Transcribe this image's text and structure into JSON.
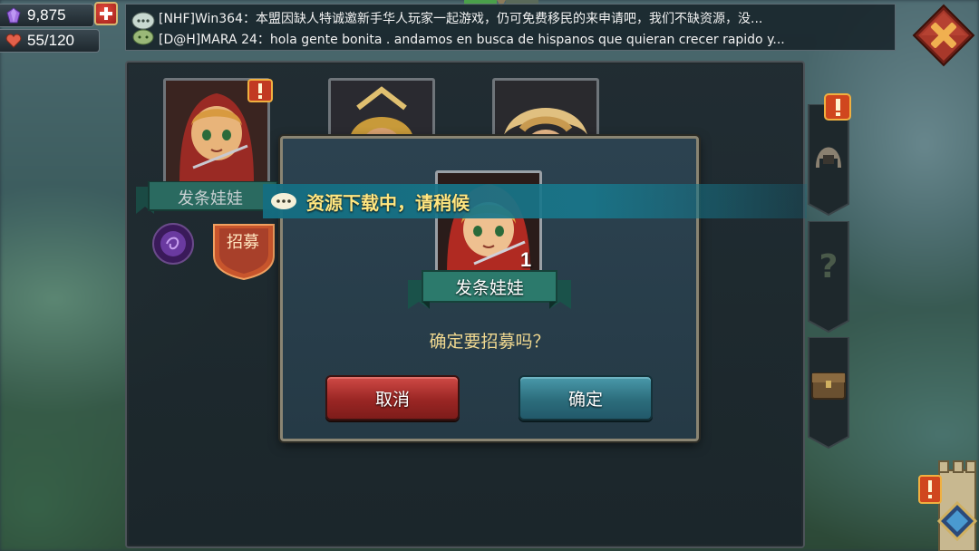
{
  "resources": {
    "gems": "9,875",
    "stamina": "55/120"
  },
  "chat": {
    "line1": "[NHF]Win364：本盟因缺人特诚邀新手华人玩家一起游戏，仍可免费移民的来申请吧，我们不缺资源，没...",
    "line2": "[D@H]MARA 24：hola gente bonita . andamos en busca de hispanos que quieran crecer rapido y..."
  },
  "background_hero": {
    "name": "发条娃娃",
    "recruit_label": "招募"
  },
  "banner": {
    "text": "资源下载中，请稍候"
  },
  "dialog": {
    "hero_name": "发条娃娃",
    "count": "1",
    "question": "确定要招募吗？",
    "cancel_label": "取消",
    "confirm_label": "确定"
  },
  "colors": {
    "accent_gold": "#f0d890",
    "banner_text": "#ffe680",
    "cancel_red": "#9a2624",
    "confirm_teal": "#2c6d7c",
    "close_red": "#8a2a1e"
  }
}
